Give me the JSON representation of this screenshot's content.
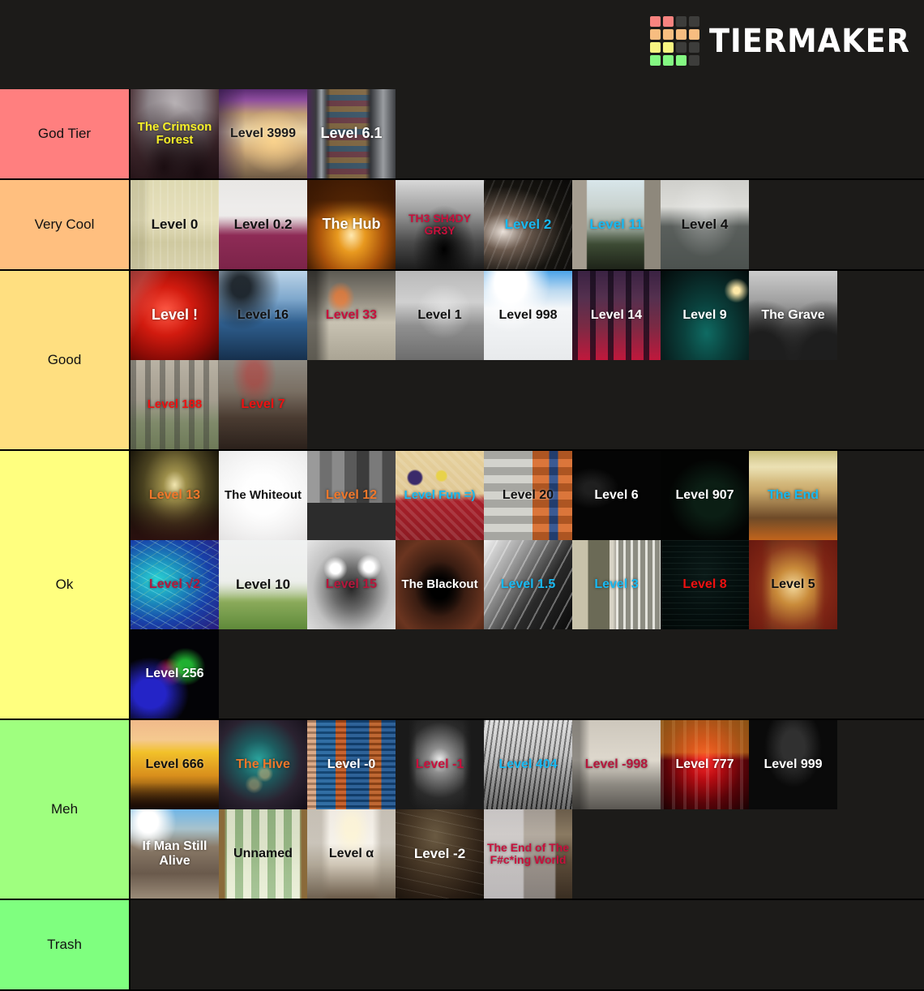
{
  "app": {
    "brand": "TIERMAKER",
    "logo_colors": [
      [
        "#f8837f",
        "#f8837f",
        "#3d3d3b",
        "#3d3d3b"
      ],
      [
        "#f8bd80",
        "#f8bd80",
        "#f8bd80",
        "#f8bd80"
      ],
      [
        "#f8f581",
        "#f8f581",
        "#3d3d3b",
        "#3d3d3b"
      ],
      [
        "#84f882",
        "#84f882",
        "#84f882",
        "#3d3d3b"
      ]
    ],
    "background": "#1c1b19"
  },
  "tiers": [
    {
      "label": "God Tier",
      "color": "#ff7f7f",
      "items": [
        {
          "caption": "The Crimson Forest",
          "color": "#f6ef28",
          "scene": "sc-crimson",
          "font_size": 15
        },
        {
          "caption": "Level 3999",
          "color": "#1d1d1d",
          "scene": "sc-mall3999",
          "font_size": 16
        },
        {
          "caption": "Level 6.1",
          "color": "#ffffff",
          "scene": "sc-vending",
          "font_size": 18
        }
      ]
    },
    {
      "label": "Very Cool",
      "color": "#ffbf7f",
      "items": [
        {
          "caption": "Level 0",
          "color": "#111111",
          "scene": "sc-lvl0",
          "font_size": 17
        },
        {
          "caption": "Level 0.2",
          "color": "#111111",
          "scene": "sc-lvl02",
          "font_size": 17
        },
        {
          "caption": "The Hub",
          "color": "#ffffff",
          "scene": "sc-hub",
          "font_size": 18
        },
        {
          "caption": "TH3 SH4DY GR3Y",
          "color": "#c8103c",
          "scene": "sc-shady",
          "font_size": 14
        },
        {
          "caption": "Level 2",
          "color": "#17b9f2",
          "scene": "sc-lvl2",
          "font_size": 17
        },
        {
          "caption": "Level 11",
          "color": "#17b9f2",
          "scene": "sc-lvl11",
          "font_size": 17
        },
        {
          "caption": "Level 4",
          "color": "#111111",
          "scene": "sc-lvl4",
          "font_size": 17
        }
      ]
    },
    {
      "label": "Good",
      "color": "#ffdf80",
      "items": [
        {
          "caption": "Level !",
          "color": "#ffffff",
          "scene": "sc-lvlbang",
          "font_size": 18
        },
        {
          "caption": "Level 16",
          "color": "#111111",
          "scene": "sc-lvl16",
          "font_size": 16
        },
        {
          "caption": "Level 33",
          "color": "#c8103c",
          "scene": "sc-lvl33",
          "font_size": 16
        },
        {
          "caption": "Level 1",
          "color": "#111111",
          "scene": "sc-lvl1",
          "font_size": 16
        },
        {
          "caption": "Level 998",
          "color": "#111111",
          "scene": "sc-lvl998",
          "font_size": 16
        },
        {
          "caption": "Level 14",
          "color": "#ffffff",
          "scene": "sc-lvl14",
          "font_size": 16
        },
        {
          "caption": "Level 9",
          "color": "#ffffff",
          "scene": "sc-lvl9",
          "font_size": 16
        },
        {
          "caption": "The Grave",
          "color": "#ffffff",
          "scene": "sc-grave",
          "font_size": 16
        },
        {
          "caption": "Level 188",
          "color": "#ee1111",
          "scene": "sc-lvl188",
          "font_size": 15
        },
        {
          "caption": "Level 7",
          "color": "#ee1111",
          "scene": "sc-lvl7",
          "font_size": 16
        }
      ]
    },
    {
      "label": "Ok",
      "color": "#ffff7f",
      "items": [
        {
          "caption": "Level 13",
          "color": "#f0772a",
          "scene": "sc-lvl13",
          "font_size": 16
        },
        {
          "caption": "The Whiteout",
          "color": "#111111",
          "scene": "sc-whiteout",
          "font_size": 15
        },
        {
          "caption": "Level 12",
          "color": "#f0772a",
          "scene": "sc-lvl12",
          "font_size": 16
        },
        {
          "caption": "Level Fun =)",
          "color": "#17b9f2",
          "scene": "sc-lvlfun",
          "font_size": 15
        },
        {
          "caption": "Level 20",
          "color": "#111111",
          "scene": "sc-lvl20",
          "font_size": 16
        },
        {
          "caption": "Level 6",
          "color": "#ffffff",
          "scene": "sc-lvl6",
          "font_size": 16
        },
        {
          "caption": "Level 907",
          "color": "#ffffff",
          "scene": "sc-lvl907",
          "font_size": 16
        },
        {
          "caption": "The End",
          "color": "#17b9f2",
          "scene": "sc-theend",
          "font_size": 16
        },
        {
          "caption": "Level √2",
          "color": "#b5173c",
          "scene": "sc-lvlsqrt2",
          "font_size": 16
        },
        {
          "caption": "Level 10",
          "color": "#111111",
          "scene": "sc-lvl10",
          "font_size": 17
        },
        {
          "caption": "Level 15",
          "color": "#b5173c",
          "scene": "sc-lvl15",
          "font_size": 16
        },
        {
          "caption": "The Blackout",
          "color": "#ffffff",
          "scene": "sc-blackout",
          "font_size": 15
        },
        {
          "caption": "Level 1.5",
          "color": "#17b9f2",
          "scene": "sc-lvl15b",
          "font_size": 16
        },
        {
          "caption": "Level 3",
          "color": "#17b9f2",
          "scene": "sc-lvl3",
          "font_size": 16
        },
        {
          "caption": "Level 8",
          "color": "#ee1111",
          "scene": "sc-lvl8",
          "font_size": 16
        },
        {
          "caption": "Level 5",
          "color": "#111111",
          "scene": "sc-lvl5",
          "font_size": 16
        },
        {
          "caption": "Level 256",
          "color": "#ffffff",
          "scene": "sc-lvl256",
          "font_size": 16
        }
      ]
    },
    {
      "label": "Meh",
      "color": "#9fff7f",
      "items": [
        {
          "caption": "Level 666",
          "color": "#111111",
          "scene": "sc-lvl666",
          "font_size": 16
        },
        {
          "caption": "The Hive",
          "color": "#f0772a",
          "scene": "sc-hive",
          "font_size": 16
        },
        {
          "caption": "Level -0",
          "color": "#ffffff",
          "scene": "sc-lvlneg0",
          "font_size": 16
        },
        {
          "caption": "Level -1",
          "color": "#c8103c",
          "scene": "sc-lvlneg1",
          "font_size": 16
        },
        {
          "caption": "Level 404",
          "color": "#17b9f2",
          "scene": "sc-lvl404",
          "font_size": 16
        },
        {
          "caption": "Level -998",
          "color": "#b5173c",
          "scene": "sc-lvlneg998",
          "font_size": 16
        },
        {
          "caption": "Level 777",
          "color": "#ffffff",
          "scene": "sc-lvl777",
          "font_size": 16
        },
        {
          "caption": "Level 999",
          "color": "#ffffff",
          "scene": "sc-lvl999",
          "font_size": 16
        },
        {
          "caption": "If Man Still Alive",
          "color": "#ffffff",
          "scene": "sc-ifman",
          "font_size": 16
        },
        {
          "caption": "Unnamed",
          "color": "#111111",
          "scene": "sc-unnamed",
          "font_size": 16
        },
        {
          "caption": "Level α",
          "color": "#111111",
          "scene": "sc-lvlalpha",
          "font_size": 16
        },
        {
          "caption": "Level -2",
          "color": "#ffffff",
          "scene": "sc-lvlneg2",
          "font_size": 17
        },
        {
          "caption": "The End of The F#c*ing World",
          "color": "#c8103c",
          "scene": "sc-endworld",
          "font_size": 14
        }
      ]
    },
    {
      "label": "Trash",
      "color": "#7fff7f",
      "items": []
    }
  ]
}
